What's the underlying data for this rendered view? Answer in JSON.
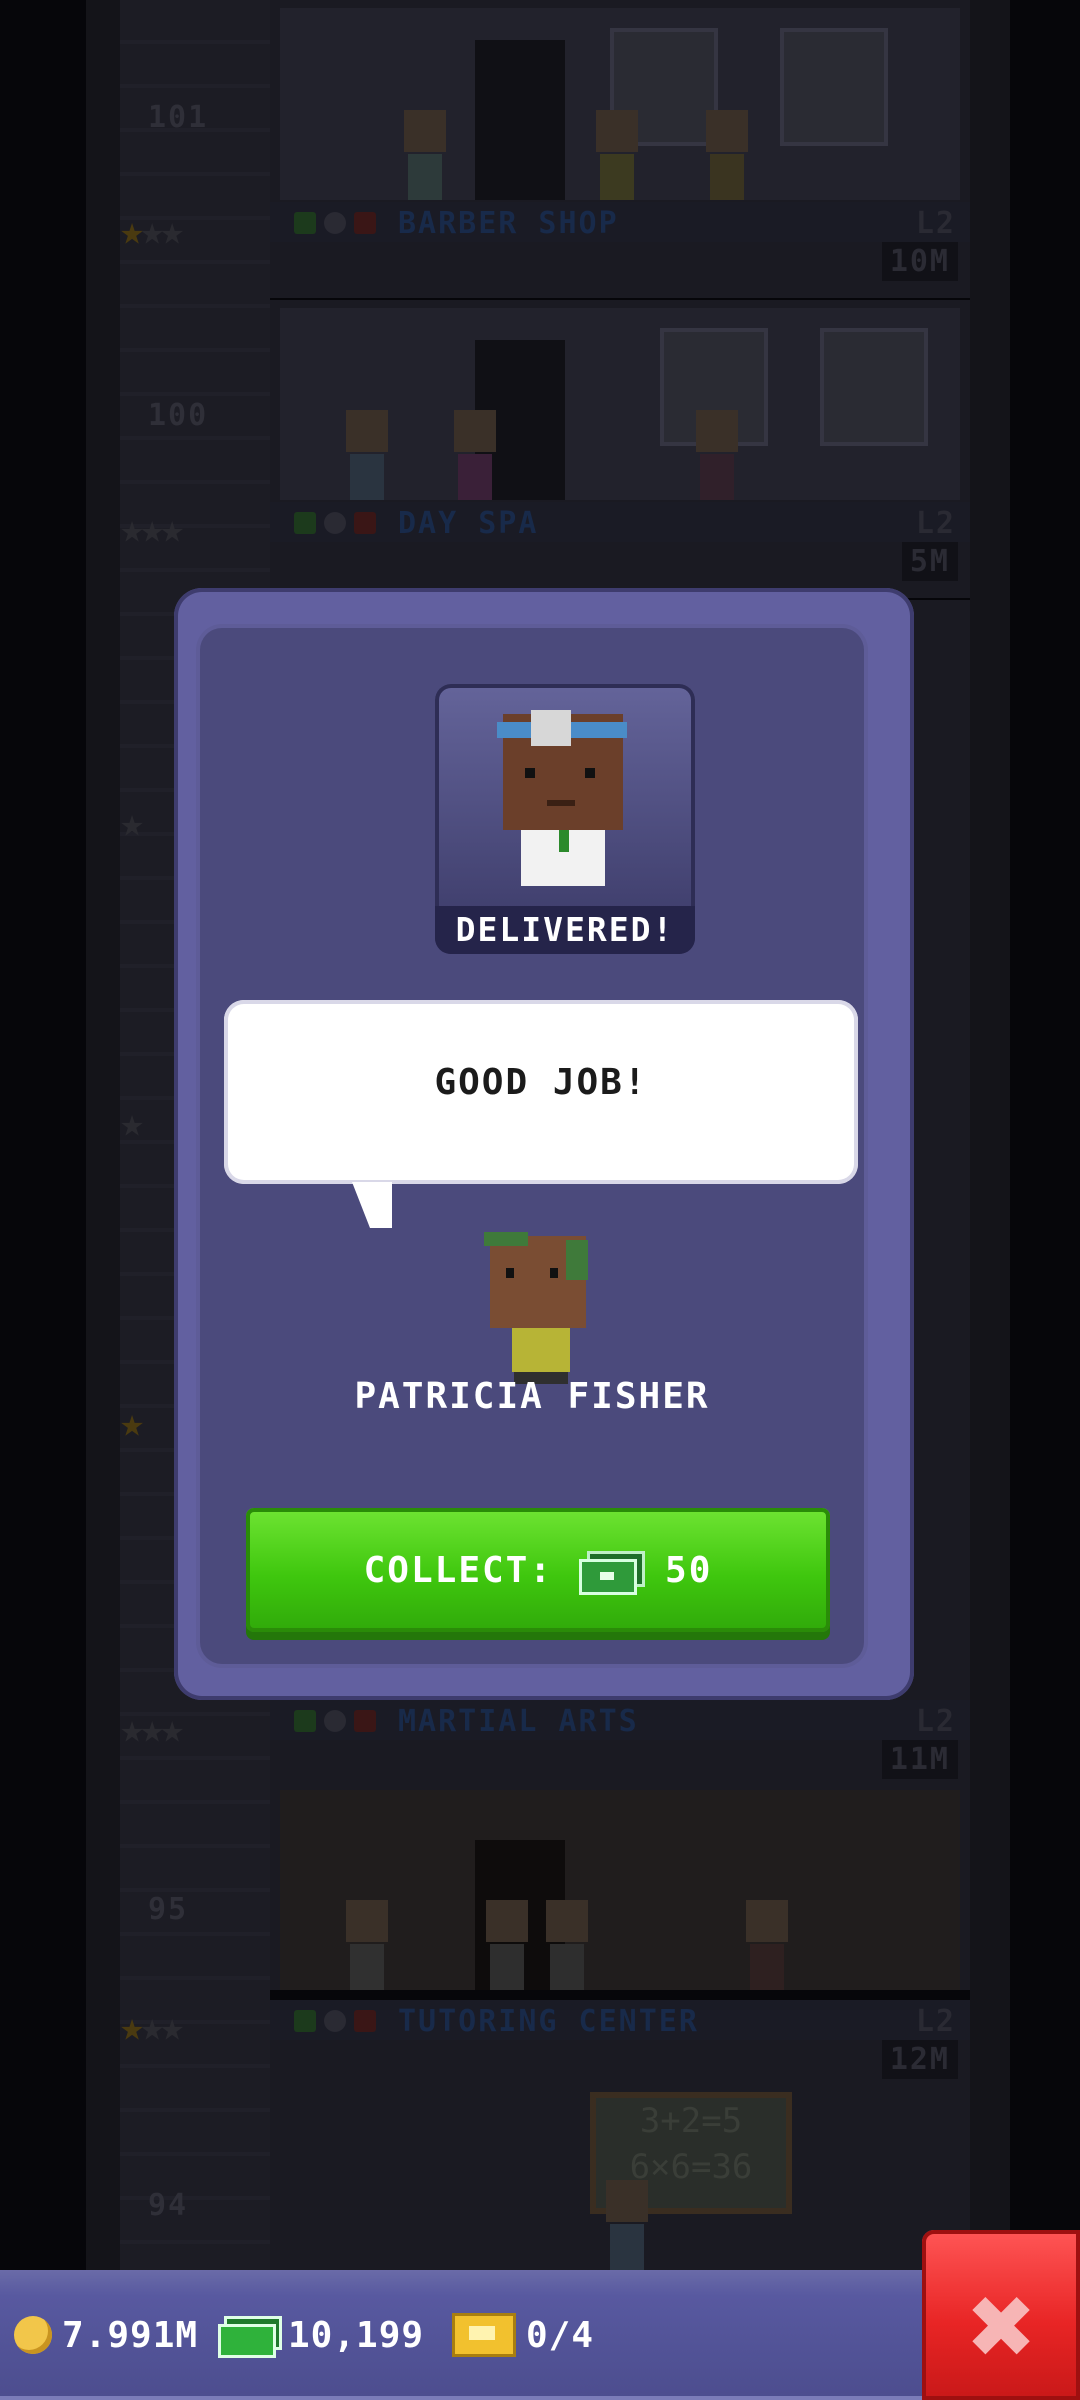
{
  "tower": {
    "floors": [
      {
        "name": "BARBER SHOP",
        "level": "L2",
        "cost": "10M",
        "number": "101"
      },
      {
        "name": "DAY SPA",
        "level": "L2",
        "cost": "5M",
        "number": "100"
      },
      {
        "name": "MARTIAL ARTS",
        "level": "L2",
        "cost": "11M",
        "number": "95"
      },
      {
        "name": "TUTORING CENTER",
        "level": "L2",
        "cost": "12M",
        "number": "94"
      }
    ],
    "chalkboard": {
      "line1": "3+2=5",
      "line2": "6×6=36"
    }
  },
  "modal": {
    "portrait_banner": "DELIVERED!",
    "speech": "GOOD JOB!",
    "character_name": "PATRICIA FISHER",
    "collect_label": "COLLECT:",
    "collect_amount": "50"
  },
  "bottom_bar": {
    "coins": "7.991M",
    "bux": "10,199",
    "tickets": "0/4"
  },
  "icons": {
    "coin": "coin-icon",
    "bux": "bux-icon",
    "ticket": "vip-ticket-icon",
    "close": "close-icon"
  },
  "colors": {
    "modal": "#4b4a7c",
    "collect_button": "#3fc70e",
    "close_button": "#e82525",
    "bottom_bar": "#5859a0"
  }
}
